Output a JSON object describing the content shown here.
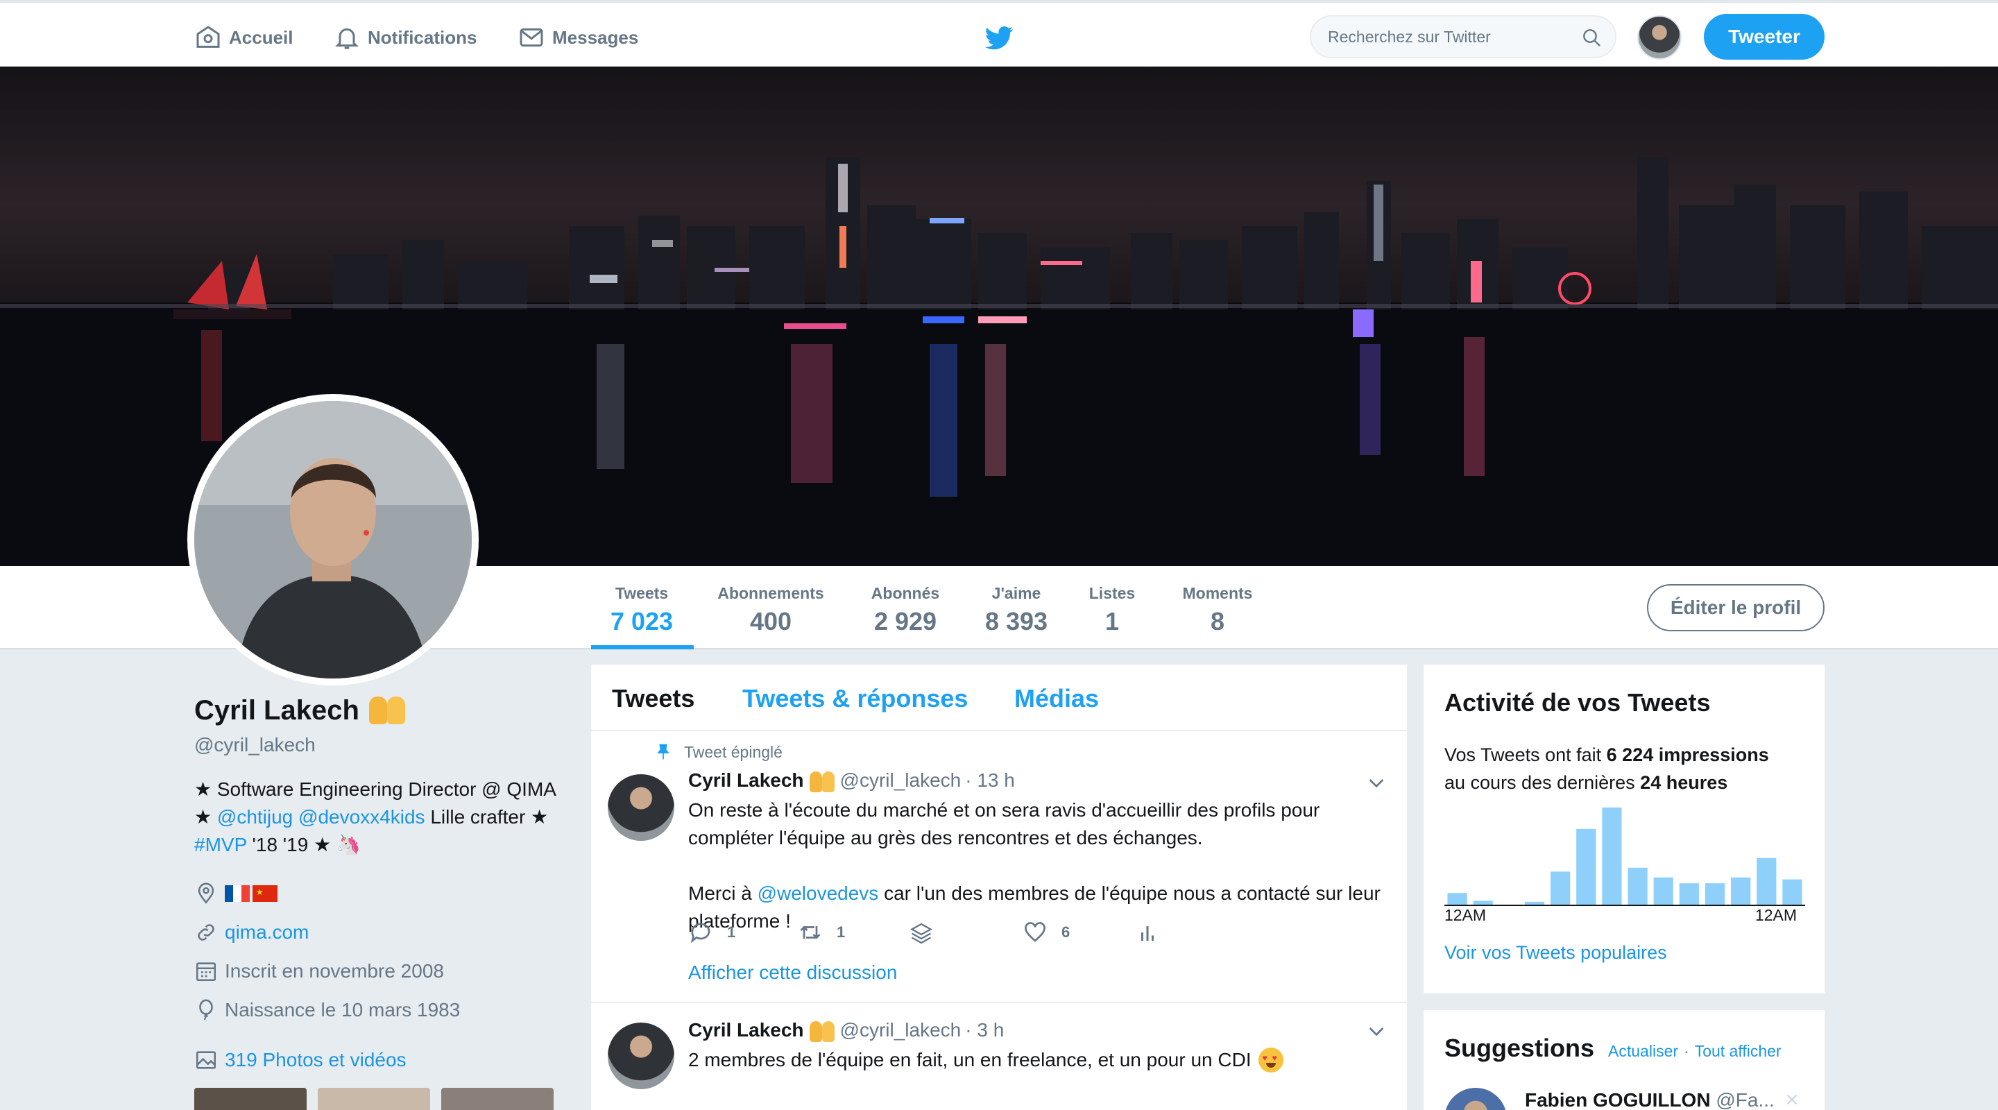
{
  "nav": {
    "home": "Accueil",
    "notifications": "Notifications",
    "messages": "Messages",
    "search_placeholder": "Recherchez sur Twitter",
    "tweet_button": "Tweeter"
  },
  "stats": [
    {
      "label": "Tweets",
      "value": "7 023"
    },
    {
      "label": "Abonnements",
      "value": "400"
    },
    {
      "label": "Abonnés",
      "value": "2 929"
    },
    {
      "label": "J'aime",
      "value": "8 393"
    },
    {
      "label": "Listes",
      "value": "1"
    },
    {
      "label": "Moments",
      "value": "8"
    }
  ],
  "edit_profile": "Éditer le profil",
  "profile": {
    "name": "Cyril Lakech",
    "handle": "@cyril_lakech",
    "bio_line1": "★ Software Engineering Director @ QIMA",
    "bio_star": "★",
    "bio_mention1": "@chtijug",
    "bio_mention2": "@devoxx4kids",
    "bio_line2_tail": "Lille crafter ★",
    "bio_hashtag": "#MVP",
    "bio_line3_tail": "'18 '19 ★ 🦄",
    "website": "qima.com",
    "joined": "Inscrit en novembre 2008",
    "birth": "Naissance le 10 mars 1983",
    "media": "319 Photos et vidéos"
  },
  "timeline": {
    "tabs": [
      "Tweets",
      "Tweets & réponses",
      "Médias"
    ],
    "pinned_label": "Tweet épinglé",
    "tweets": [
      {
        "name": "Cyril Lakech",
        "handle": "@cyril_lakech",
        "time": "· 13 h",
        "text1": "On reste à l'écoute du marché et on sera ravis d'accueillir des profils pour compléter l'équipe au grès des rencontres et des échanges.",
        "text2_pre": "Merci à",
        "text2_mention": "@welovedevs",
        "text2_post": "car l'un des membres de l'équipe nous a contacté sur leur plateforme !",
        "replies": "1",
        "retweets": "1",
        "likes": "6",
        "show_thread": "Afficher cette discussion"
      },
      {
        "name": "Cyril Lakech",
        "handle": "@cyril_lakech",
        "time": "· 3 h",
        "text1": "2 membres de l'équipe en fait, un en freelance, et un pour un CDI"
      }
    ]
  },
  "activity": {
    "title": "Activité de vos Tweets",
    "line1_pre": "Vos Tweets ont fait",
    "line1_bold": "6 224 impressions",
    "line2_pre": "au cours des dernières",
    "line2_bold": "24 heures",
    "axis_start": "12AM",
    "axis_end": "12AM",
    "link": "Voir vos Tweets populaires"
  },
  "chart_data": {
    "type": "bar",
    "values": [
      0.12,
      0.04,
      0.0,
      0.03,
      0.34,
      0.78,
      1.0,
      0.38,
      0.28,
      0.22,
      0.22,
      0.28,
      0.48,
      0.26
    ],
    "x_start_label": "12AM",
    "x_end_label": "12AM",
    "color": "#8ed0f9"
  },
  "suggestions": {
    "title": "Suggestions",
    "refresh": "Actualiser",
    "separator": "·",
    "view_all": "Tout afficher",
    "first_name": "Fabien GOGUILLON",
    "first_handle": "@Fa..."
  },
  "colors": {
    "accent": "#1da1f2",
    "link": "#1b95e0",
    "muted": "#657786"
  }
}
